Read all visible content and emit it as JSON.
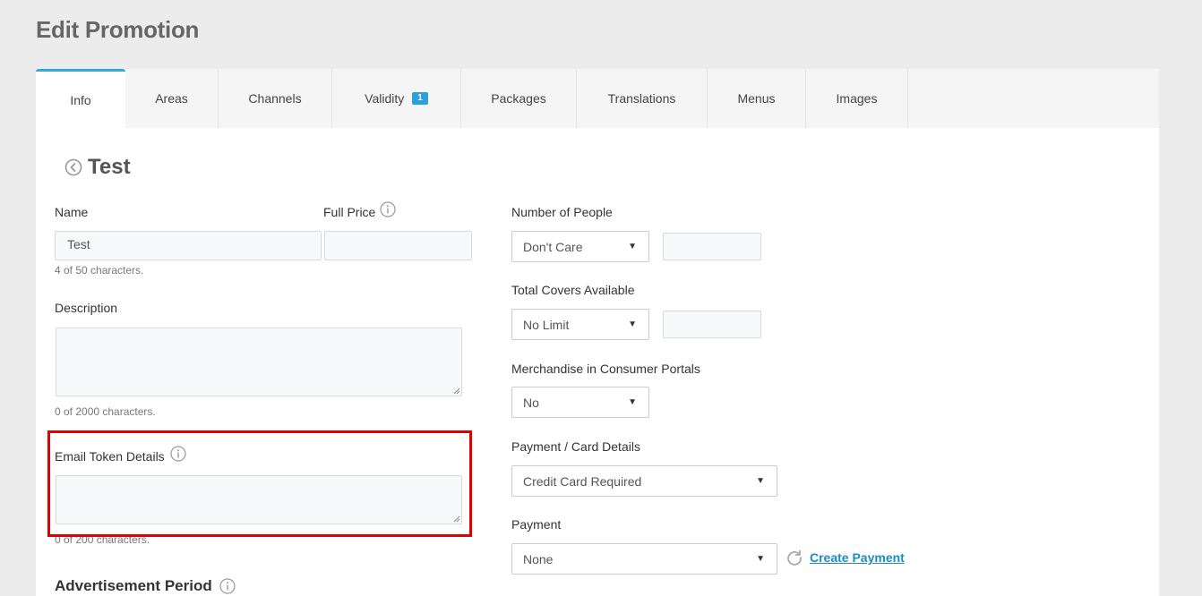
{
  "page": {
    "title": "Edit Promotion"
  },
  "tabs": [
    {
      "label": "Info"
    },
    {
      "label": "Areas"
    },
    {
      "label": "Channels"
    },
    {
      "label": "Validity",
      "badge": "1"
    },
    {
      "label": "Packages"
    },
    {
      "label": "Translations"
    },
    {
      "label": "Menus"
    },
    {
      "label": "Images"
    }
  ],
  "promotion": {
    "title": "Test"
  },
  "form": {
    "name": {
      "label": "Name",
      "value": "Test",
      "hint": "4 of 50 characters."
    },
    "full_price": {
      "label": "Full Price",
      "value": ""
    },
    "description": {
      "label": "Description",
      "value": "",
      "hint": "0 of 2000 characters."
    },
    "email_token": {
      "label": "Email Token Details",
      "value": "",
      "hint": "0 of 200 characters."
    },
    "advertisement_period": {
      "label": "Advertisement Period"
    },
    "number_of_people": {
      "label": "Number of People",
      "selected": "Don't Care",
      "value": ""
    },
    "total_covers": {
      "label": "Total Covers Available",
      "selected": "No Limit",
      "value": ""
    },
    "merchandise": {
      "label": "Merchandise in Consumer Portals",
      "selected": "No"
    },
    "payment_card": {
      "label": "Payment / Card Details",
      "selected": "Credit Card Required"
    },
    "payment": {
      "label": "Payment",
      "selected": "None",
      "create_link": "Create Payment"
    }
  },
  "icons": {
    "back": "chevron-left-circle-icon",
    "info": "info-circle-icon",
    "refresh": "refresh-icon",
    "dropdown": "caret-down-icon"
  },
  "colors": {
    "accent": "#2eaadc",
    "link": "#1b8bc4",
    "highlight": "#e00000",
    "badge": "#2e9fd8"
  }
}
